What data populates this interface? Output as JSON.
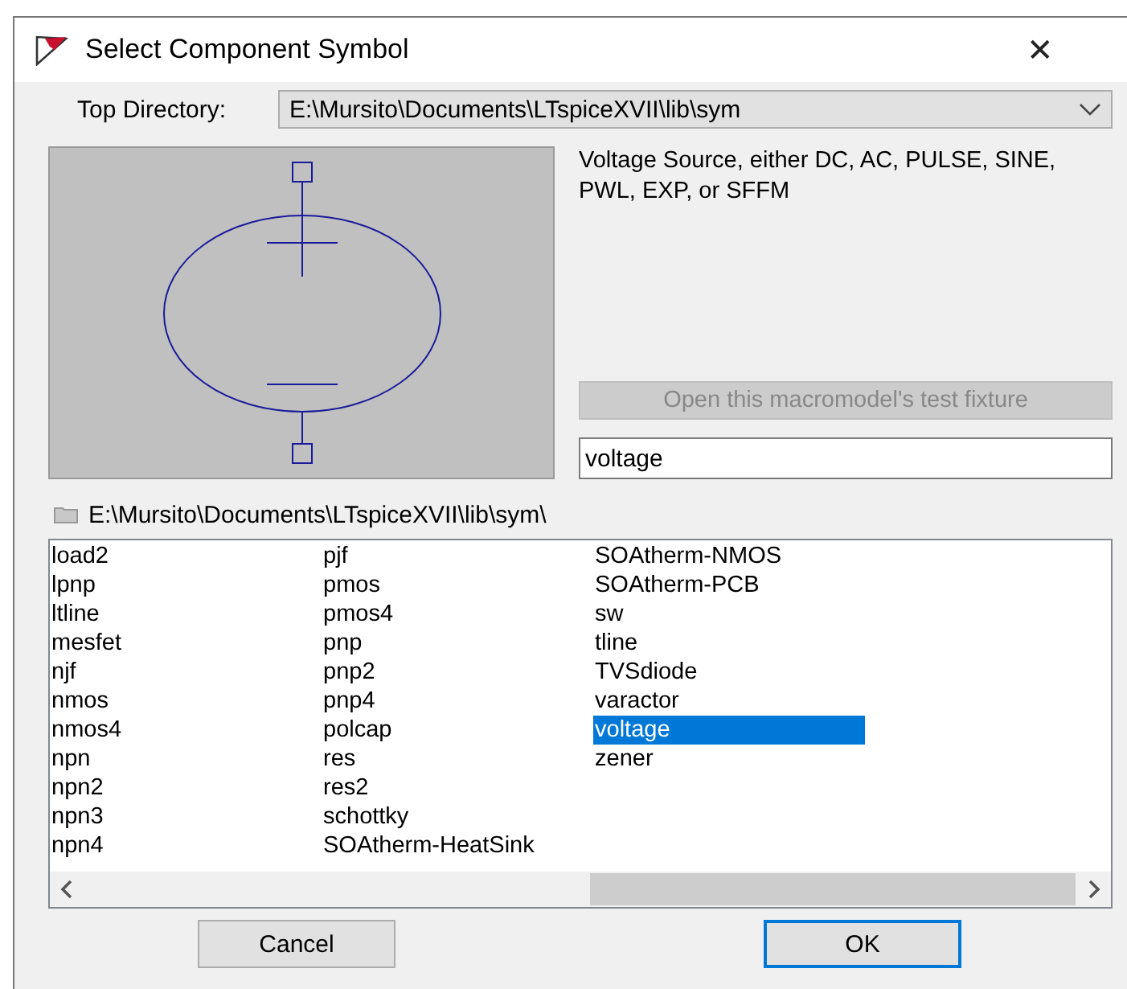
{
  "window": {
    "title": "Select Component Symbol",
    "close_glyph": "✕"
  },
  "top_directory": {
    "label": "Top Directory:",
    "value": "E:\\Mursito\\Documents\\LTspiceXVII\\lib\\sym"
  },
  "description": "Voltage Source, either DC, AC, PULSE, SINE, PWL, EXP, or SFFM",
  "test_fixture_button": {
    "label": "Open this macromodel's test fixture",
    "disabled": true
  },
  "search": {
    "value": "voltage"
  },
  "current_path": "E:\\Mursito\\Documents\\LTspiceXVII\\lib\\sym\\",
  "list": {
    "columns": [
      [
        {
          "name": "load2",
          "selected": false
        },
        {
          "name": "lpnp",
          "selected": false
        },
        {
          "name": "ltline",
          "selected": false
        },
        {
          "name": "mesfet",
          "selected": false
        },
        {
          "name": "njf",
          "selected": false
        },
        {
          "name": "nmos",
          "selected": false
        },
        {
          "name": "nmos4",
          "selected": false
        },
        {
          "name": "npn",
          "selected": false
        },
        {
          "name": "npn2",
          "selected": false
        },
        {
          "name": "npn3",
          "selected": false
        },
        {
          "name": "npn4",
          "selected": false
        }
      ],
      [
        {
          "name": "pjf",
          "selected": false
        },
        {
          "name": "pmos",
          "selected": false
        },
        {
          "name": "pmos4",
          "selected": false
        },
        {
          "name": "pnp",
          "selected": false
        },
        {
          "name": "pnp2",
          "selected": false
        },
        {
          "name": "pnp4",
          "selected": false
        },
        {
          "name": "polcap",
          "selected": false
        },
        {
          "name": "res",
          "selected": false
        },
        {
          "name": "res2",
          "selected": false
        },
        {
          "name": "schottky",
          "selected": false
        },
        {
          "name": "SOAtherm-HeatSink",
          "selected": false
        }
      ],
      [
        {
          "name": "SOAtherm-NMOS",
          "selected": false
        },
        {
          "name": "SOAtherm-PCB",
          "selected": false
        },
        {
          "name": "sw",
          "selected": false
        },
        {
          "name": "tline",
          "selected": false
        },
        {
          "name": "TVSdiode",
          "selected": false
        },
        {
          "name": "varactor",
          "selected": false
        },
        {
          "name": "voltage",
          "selected": true
        },
        {
          "name": "zener",
          "selected": false
        }
      ]
    ]
  },
  "buttons": [
    {
      "label": "Cancel",
      "default": false
    },
    {
      "label": "OK",
      "default": true
    }
  ]
}
